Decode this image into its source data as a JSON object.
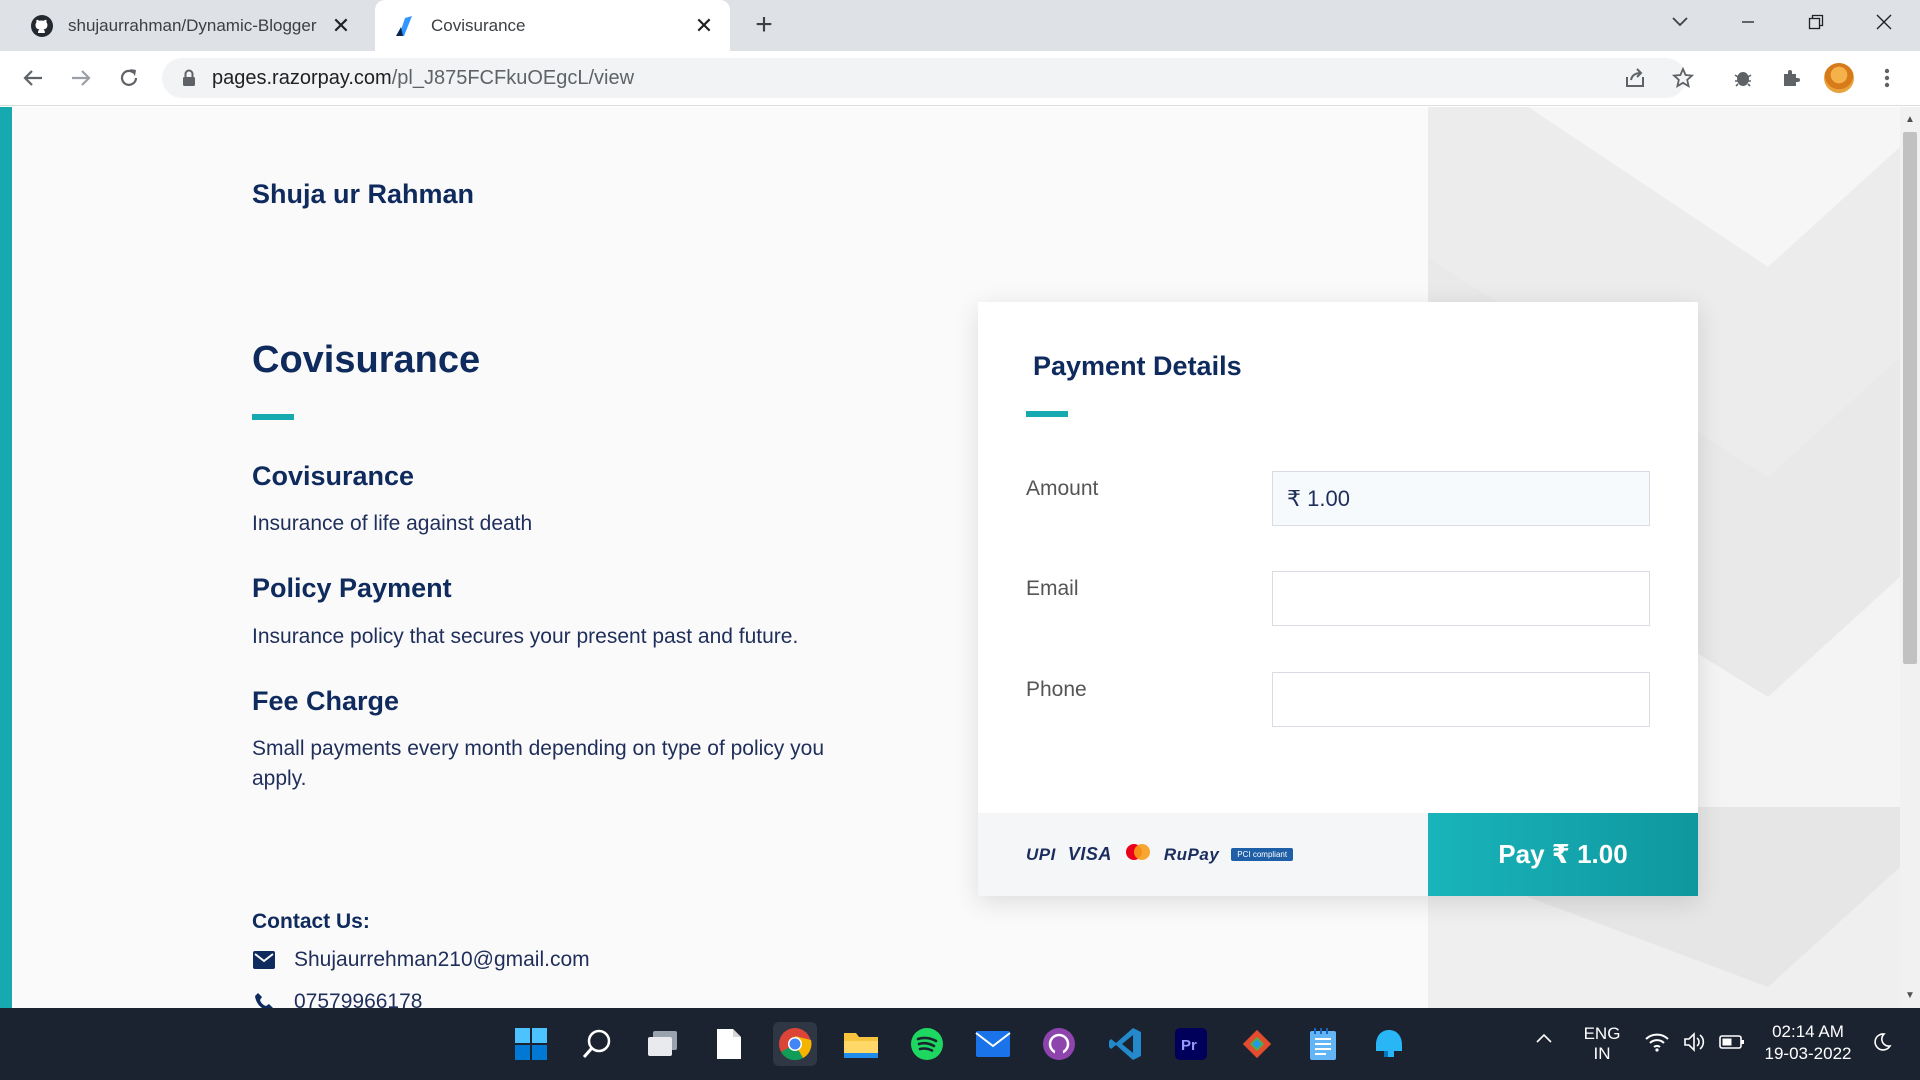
{
  "browser": {
    "tabs": [
      {
        "title": "shujaurrahman/Dynamic-Blogger",
        "close": "✕",
        "favicon": "github-icon"
      },
      {
        "title": "Covisurance",
        "close": "✕",
        "favicon": "razorpay-icon"
      }
    ],
    "new_tab": "+",
    "url_host": "pages.razorpay.com",
    "url_path": "/pl_J875FCFkuOEgcL/view"
  },
  "page": {
    "merchant_name": "Shuja ur Rahman",
    "title": "Covisurance",
    "sections": [
      {
        "heading": "Covisurance",
        "text": "Insurance of life against death"
      },
      {
        "heading": "Policy Payment",
        "text": "Insurance policy that secures your present past and future."
      },
      {
        "heading": "Fee Charge",
        "text": "Small payments every month depending on type of policy you apply."
      }
    ],
    "contact": {
      "heading": "Contact Us:",
      "email": "Shujaurrehman210@gmail.com",
      "phone": "07579966178"
    }
  },
  "payment": {
    "title": "Payment Details",
    "fields": [
      {
        "label": "Amount",
        "value": "₹ 1.00"
      },
      {
        "label": "Email",
        "value": ""
      },
      {
        "label": "Phone",
        "value": ""
      }
    ],
    "methods": [
      "UPI",
      "VISA",
      "RuPay",
      "PCI compliant"
    ],
    "pay_button": "Pay  ₹ 1.00"
  },
  "taskbar": {
    "language": "ENG",
    "region": "IN",
    "time": "02:14 AM",
    "date": "19-03-2022"
  },
  "colors": {
    "accent": "#17a9b0",
    "navy": "#0f2a5c"
  }
}
